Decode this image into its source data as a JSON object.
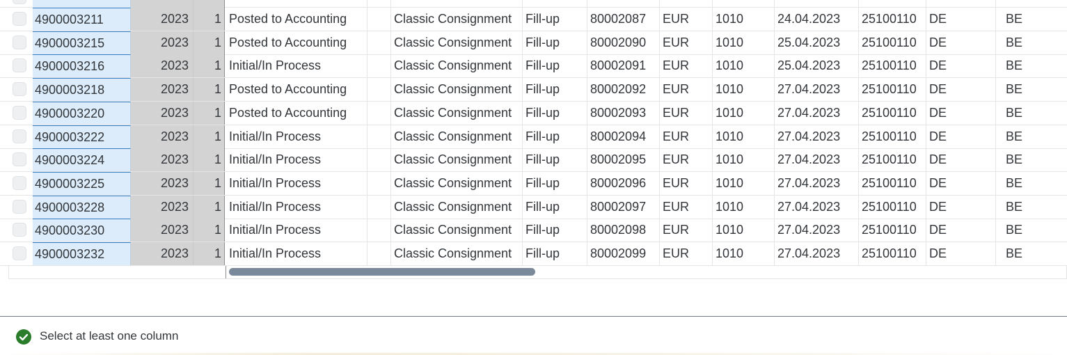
{
  "table": {
    "rows": [
      {
        "doc": "4900003211",
        "year": "2023",
        "item": "1",
        "status": "Posted to Accounting",
        "process": "Classic Consignment",
        "type": "Fill-up",
        "number": "80002087",
        "currency": "EUR",
        "plant": "1010",
        "date": "24.04.2023",
        "account": "25100110",
        "from": "DE",
        "to": "BE"
      },
      {
        "doc": "4900003215",
        "year": "2023",
        "item": "1",
        "status": "Posted to Accounting",
        "process": "Classic Consignment",
        "type": "Fill-up",
        "number": "80002090",
        "currency": "EUR",
        "plant": "1010",
        "date": "25.04.2023",
        "account": "25100110",
        "from": "DE",
        "to": "BE"
      },
      {
        "doc": "4900003216",
        "year": "2023",
        "item": "1",
        "status": "Initial/In Process",
        "process": "Classic Consignment",
        "type": "Fill-up",
        "number": "80002091",
        "currency": "EUR",
        "plant": "1010",
        "date": "25.04.2023",
        "account": "25100110",
        "from": "DE",
        "to": "BE"
      },
      {
        "doc": "4900003218",
        "year": "2023",
        "item": "1",
        "status": "Posted to Accounting",
        "process": "Classic Consignment",
        "type": "Fill-up",
        "number": "80002092",
        "currency": "EUR",
        "plant": "1010",
        "date": "27.04.2023",
        "account": "25100110",
        "from": "DE",
        "to": "BE"
      },
      {
        "doc": "4900003220",
        "year": "2023",
        "item": "1",
        "status": "Posted to Accounting",
        "process": "Classic Consignment",
        "type": "Fill-up",
        "number": "80002093",
        "currency": "EUR",
        "plant": "1010",
        "date": "27.04.2023",
        "account": "25100110",
        "from": "DE",
        "to": "BE"
      },
      {
        "doc": "4900003222",
        "year": "2023",
        "item": "1",
        "status": "Initial/In Process",
        "process": "Classic Consignment",
        "type": "Fill-up",
        "number": "80002094",
        "currency": "EUR",
        "plant": "1010",
        "date": "27.04.2023",
        "account": "25100110",
        "from": "DE",
        "to": "BE"
      },
      {
        "doc": "4900003224",
        "year": "2023",
        "item": "1",
        "status": "Initial/In Process",
        "process": "Classic Consignment",
        "type": "Fill-up",
        "number": "80002095",
        "currency": "EUR",
        "plant": "1010",
        "date": "27.04.2023",
        "account": "25100110",
        "from": "DE",
        "to": "BE"
      },
      {
        "doc": "4900003225",
        "year": "2023",
        "item": "1",
        "status": "Initial/In Process",
        "process": "Classic Consignment",
        "type": "Fill-up",
        "number": "80002096",
        "currency": "EUR",
        "plant": "1010",
        "date": "27.04.2023",
        "account": "25100110",
        "from": "DE",
        "to": "BE"
      },
      {
        "doc": "4900003228",
        "year": "2023",
        "item": "1",
        "status": "Initial/In Process",
        "process": "Classic Consignment",
        "type": "Fill-up",
        "number": "80002097",
        "currency": "EUR",
        "plant": "1010",
        "date": "27.04.2023",
        "account": "25100110",
        "from": "DE",
        "to": "BE"
      },
      {
        "doc": "4900003230",
        "year": "2023",
        "item": "1",
        "status": "Initial/In Process",
        "process": "Classic Consignment",
        "type": "Fill-up",
        "number": "80002098",
        "currency": "EUR",
        "plant": "1010",
        "date": "27.04.2023",
        "account": "25100110",
        "from": "DE",
        "to": "BE"
      },
      {
        "doc": "4900003232",
        "year": "2023",
        "item": "1",
        "status": "Initial/In Process",
        "process": "Classic Consignment",
        "type": "Fill-up",
        "number": "80002099",
        "currency": "EUR",
        "plant": "1010",
        "date": "27.04.2023",
        "account": "25100110",
        "from": "DE",
        "to": "BE"
      }
    ]
  },
  "message": {
    "text": "Select at least one column",
    "icon": "success-check-icon",
    "icon_color": "#2b7d2b"
  },
  "colors": {
    "key_column_bg": "#dcecfa",
    "fixed_column_bg": "#d3d3d3",
    "scrollbar_thumb": "#7a8a9b"
  }
}
